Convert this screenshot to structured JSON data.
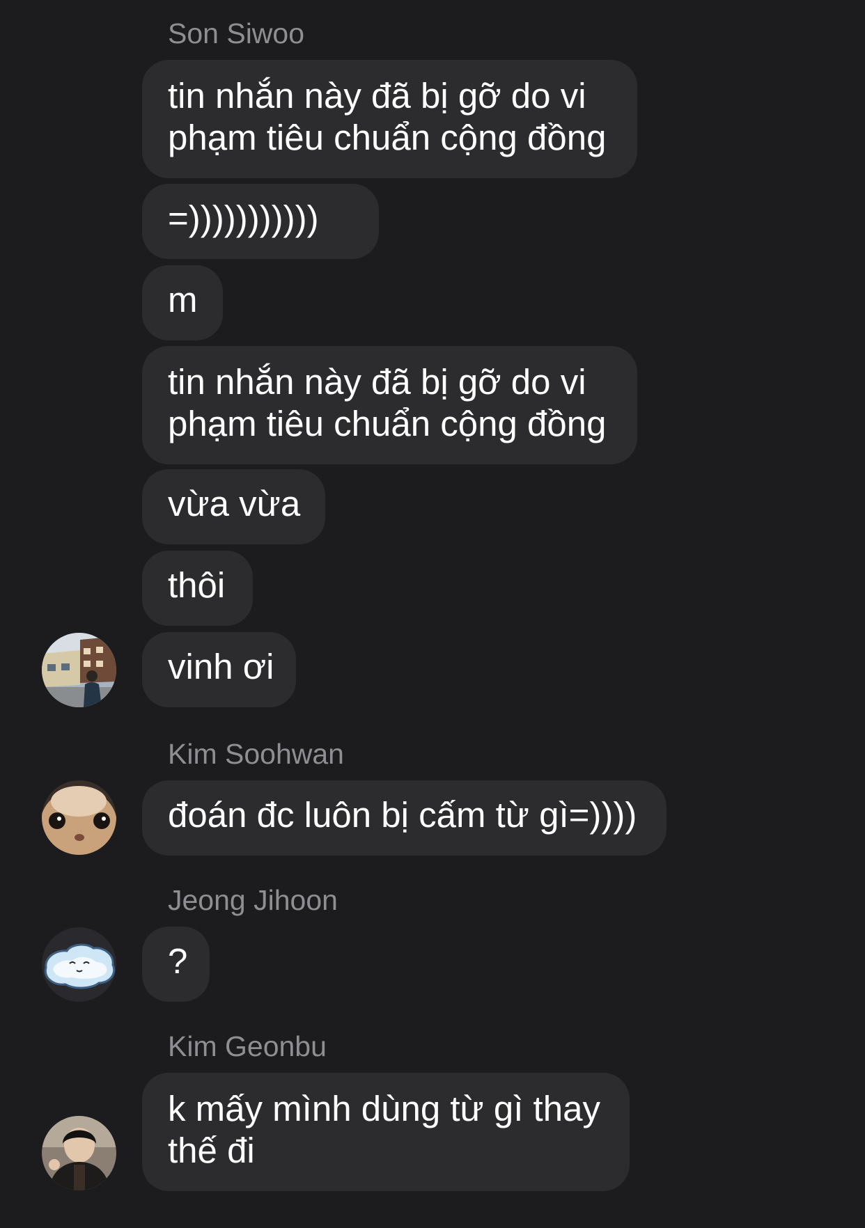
{
  "messages_groups": [
    {
      "sender": "Son Siwoo",
      "avatar": "street-photo-avatar",
      "messages": [
        {
          "lines": [
            "tin nhắn này đã bị gỡ do vi",
            "phạm tiêu chuẩn cộng đồng"
          ]
        },
        {
          "lines": [
            "=)))))))))))"
          ]
        },
        {
          "lines": [
            "m"
          ]
        },
        {
          "lines": [
            "tin nhắn này đã bị gỡ do vi",
            "phạm tiêu chuẩn cộng đồng"
          ]
        },
        {
          "lines": [
            "vừa vừa"
          ]
        },
        {
          "lines": [
            "thôi"
          ]
        },
        {
          "lines": [
            "vinh ơi"
          ]
        }
      ]
    },
    {
      "sender": "Kim Soohwan",
      "avatar": "cat-closeup-avatar",
      "messages": [
        {
          "lines": [
            "đoán đc luôn bị cấm từ gì=))))"
          ]
        }
      ]
    },
    {
      "sender": "Jeong Jihoon",
      "avatar": "cloud-sticker-avatar",
      "messages": [
        {
          "lines": [
            "?"
          ]
        }
      ]
    },
    {
      "sender": "Kim Geonbu",
      "avatar": "person-portrait-avatar",
      "messages": [
        {
          "lines": [
            "k mấy mình dùng từ gì thay",
            "thế đi"
          ]
        }
      ]
    }
  ],
  "colors": {
    "background": "#1c1c1e",
    "bubble": "#2c2c2e",
    "sender_text": "#8e8e93",
    "message_text": "#ffffff"
  }
}
